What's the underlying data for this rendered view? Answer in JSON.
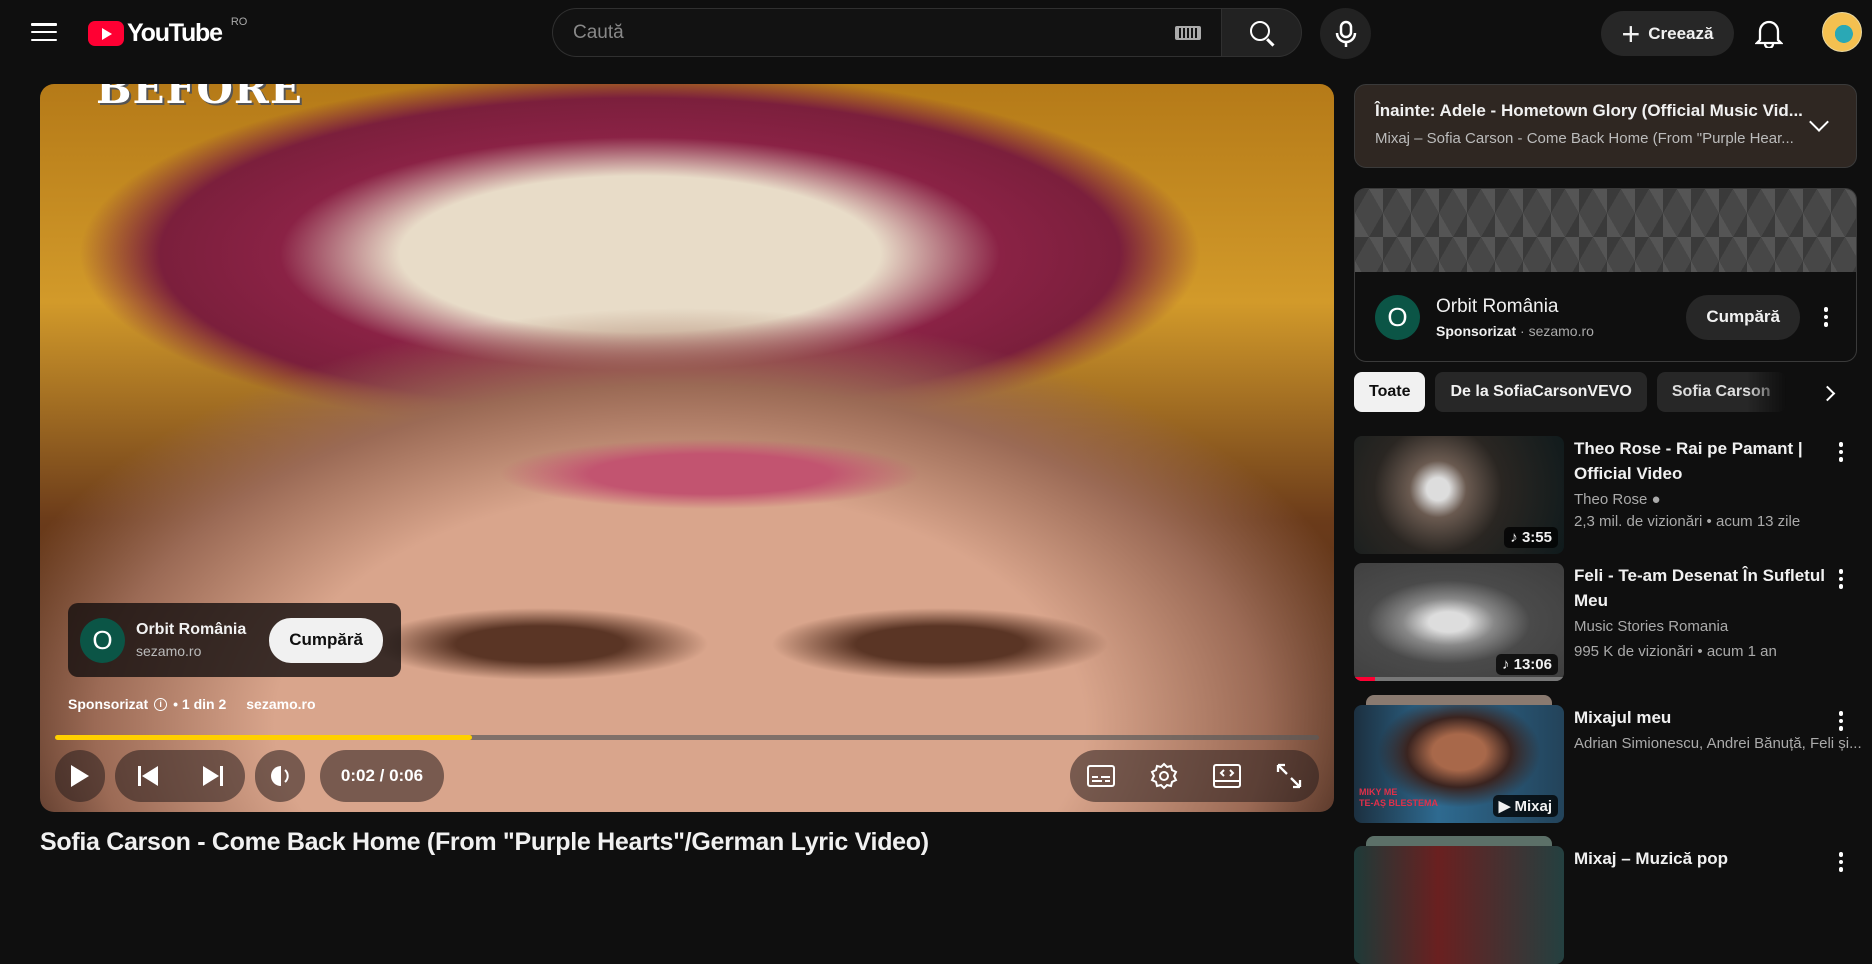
{
  "header": {
    "logo_text": "YouTube",
    "region": "RO",
    "search_placeholder": "Caută",
    "create_label": "Creează"
  },
  "player": {
    "overlay_text": "BEFORE",
    "ad": {
      "avatar_letter": "O",
      "name": "Orbit România",
      "url": "sezamo.ro",
      "button": "Cumpără"
    },
    "sponsored": "Sponsorizat",
    "ad_count": "• 1 din 2",
    "ad_url": "sezamo.ro",
    "time": "0:02 / 0:06",
    "progress_fraction": 0.33,
    "progress_color": "#ffd000"
  },
  "video_title": "Sofia Carson - Come Back Home (From \"Purple Hearts\"/German Lyric Video)",
  "sidebar": {
    "up_next": {
      "title": "Înainte: Adele - Hometown Glory (Official Music Vid...",
      "subtitle": "Mixaj – Sofia Carson - Come Back Home (From \"Purple Hear..."
    },
    "ad_card": {
      "avatar_letter": "O",
      "name": "Orbit România",
      "sponsored": "Sponsorizat",
      "url": "· sezamo.ro",
      "button": "Cumpără"
    },
    "chips": [
      "Toate",
      "De la SofiaCarsonVEVO",
      "Sofia Carson"
    ],
    "videos": [
      {
        "title": "Theo Rose - Rai pe Pamant | Official Video",
        "channel": "Theo Rose",
        "meta": "2,3 mil. de vizionări • acum 13 zile",
        "duration": "3:55"
      },
      {
        "title": "Feli - Te-am Desenat În Sufletul Meu",
        "channel": "Music Stories Romania",
        "meta": "995 K de vizionări • acum 1 an",
        "duration": "13:06",
        "watched_fraction": 0.1
      },
      {
        "title": "Mixajul meu",
        "channel": "Adrian Simionescu, Andrei Bănuță, Feli și...",
        "badge": "Mixaj",
        "thumb_text1": "MIKY ME",
        "thumb_text2": "TE-AȘ BLESTEMA"
      },
      {
        "title": "Mixaj – Muzică pop"
      }
    ]
  }
}
